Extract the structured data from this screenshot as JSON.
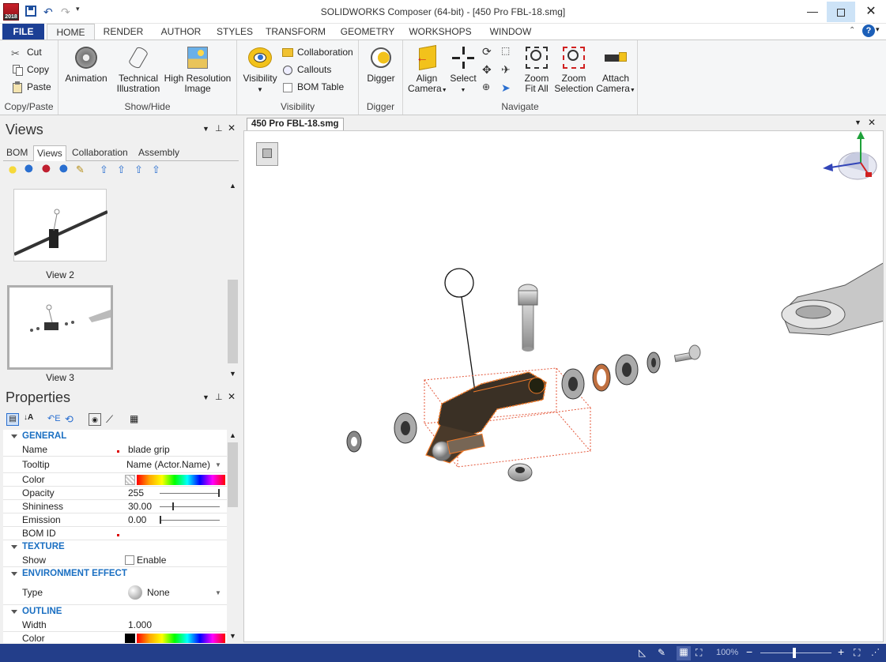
{
  "window": {
    "title": "SOLIDWORKS Composer (64-bit) - [450 Pro FBL-18.smg]",
    "app_badge": "2018"
  },
  "menu_tabs": [
    "FILE",
    "HOME",
    "RENDER",
    "AUTHOR",
    "STYLES",
    "TRANSFORM",
    "GEOMETRY",
    "WORKSHOPS",
    "WINDOW"
  ],
  "active_tab": "HOME",
  "ribbon": {
    "copy_paste": {
      "label": "Copy/Paste",
      "cut": "Cut",
      "copy": "Copy",
      "paste": "Paste"
    },
    "show_hide": {
      "label": "Show/Hide",
      "animation": "Animation",
      "tech_1": "Technical",
      "tech_2": "Illustration",
      "hires_1": "High Resolution",
      "hires_2": "Image"
    },
    "visibility": {
      "label": "Visibility",
      "visibility": "Visibility",
      "collaboration": "Collaboration",
      "callouts": "Callouts",
      "bom_table": "BOM Table"
    },
    "digger": {
      "label": "Digger",
      "digger": "Digger"
    },
    "navigate": {
      "label": "Navigate",
      "align_1": "Align",
      "align_2": "Camera",
      "select": "Select",
      "zoomfit_1": "Zoom",
      "zoomfit_2": "Fit All",
      "zoomsel_1": "Zoom",
      "zoomsel_2": "Selection",
      "attach_1": "Attach",
      "attach_2": "Camera"
    }
  },
  "views_panel": {
    "title": "Views",
    "tabs": [
      "BOM",
      "Views",
      "Collaboration",
      "Assembly"
    ],
    "active_tab": "Views",
    "items": [
      "View 2",
      "View 3"
    ]
  },
  "document_tab": "450 Pro FBL-18.smg",
  "properties": {
    "title": "Properties",
    "sections": {
      "general": "GENERAL",
      "texture": "TEXTURE",
      "environment": "ENVIRONMENT EFFECT",
      "outline": "OUTLINE"
    },
    "rows": {
      "name": {
        "k": "Name",
        "v": "blade grip"
      },
      "tooltip": {
        "k": "Tooltip",
        "v": "Name (Actor.Name)"
      },
      "color": {
        "k": "Color"
      },
      "opacity": {
        "k": "Opacity",
        "v": "255"
      },
      "shininess": {
        "k": "Shininess",
        "v": "30.00"
      },
      "emission": {
        "k": "Emission",
        "v": "0.00"
      },
      "bomid": {
        "k": "BOM ID"
      },
      "show": {
        "k": "Show",
        "v": "Enable"
      },
      "type": {
        "k": "Type",
        "v": "None"
      },
      "width": {
        "k": "Width",
        "v": "1.000"
      },
      "ocolor": {
        "k": "Color"
      }
    }
  },
  "status": {
    "zoom": "100%"
  }
}
